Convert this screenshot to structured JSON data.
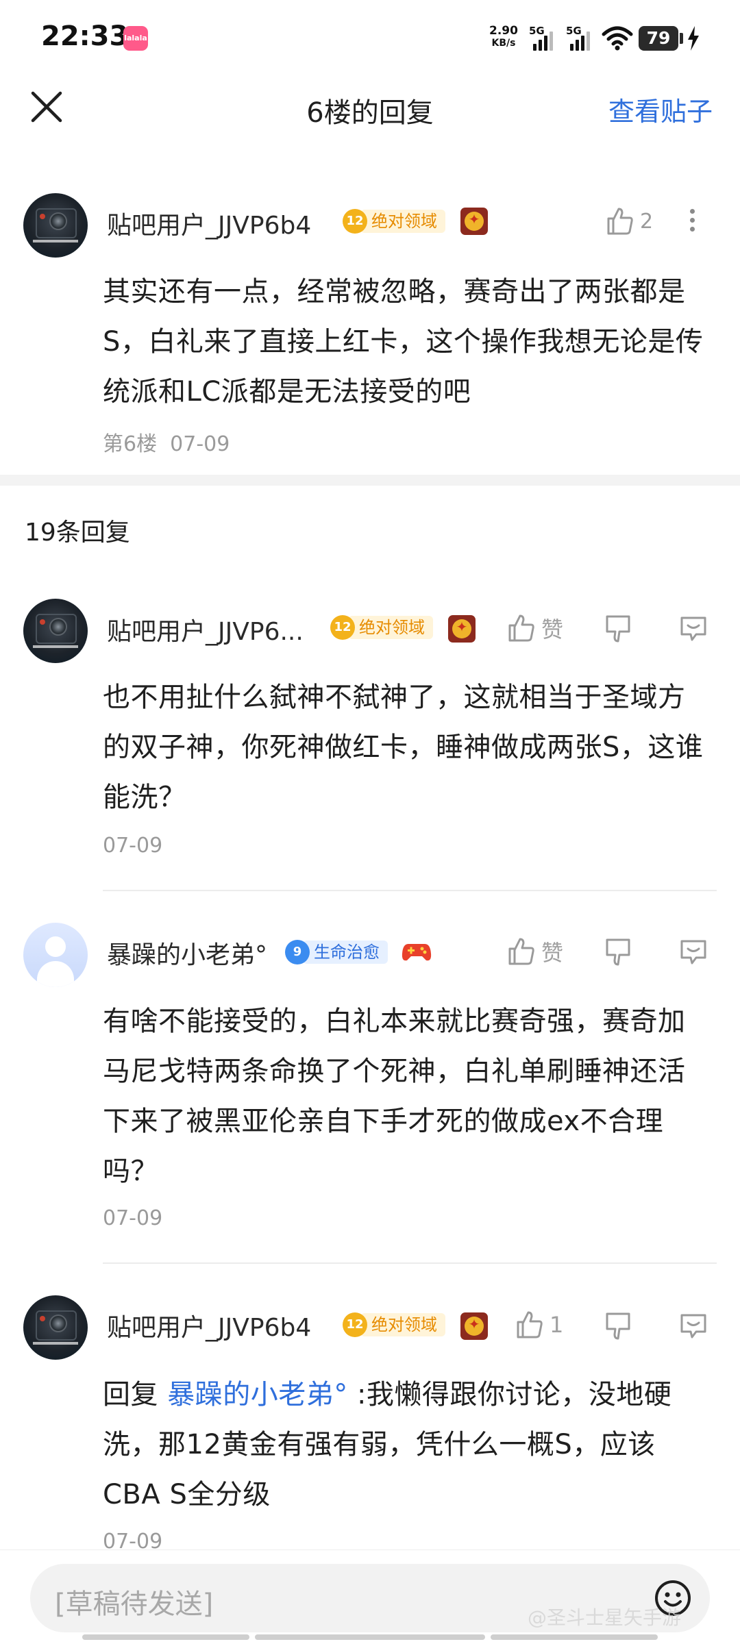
{
  "status_bar": {
    "time": "22:33",
    "app_badge": "lalala",
    "net_speed_value": "2.90",
    "net_speed_unit": "KB/s",
    "sim1": "5G",
    "sim2": "5G",
    "battery": "79"
  },
  "header": {
    "title": "6楼的回复",
    "view_post": "查看贴子"
  },
  "main_post": {
    "user": "贴吧用户_JJVP6b4",
    "level": "12",
    "title_tag": "绝对领域",
    "like_count": "2",
    "content": "其实还有一点，经常被忽略，赛奇出了两张都是S，白礼来了直接上红卡，这个操作我想无论是传统派和LC派都是无法接受的吧",
    "floor": "第6楼",
    "date": "07-09"
  },
  "reply_count": "19条回复",
  "replies": [
    {
      "user": "贴吧用户_JJVP6...",
      "level": "12",
      "title_tag": "绝对领域",
      "like_label": "赞",
      "content": "也不用扯什么弑神不弑神了，这就相当于圣域方的双子神，你死神做红卡，睡神做成两张S，这谁能洗？",
      "date": "07-09"
    },
    {
      "user": "暴躁的小老弟°",
      "level": "9",
      "title_tag": "生命治愈",
      "like_label": "赞",
      "content": "有啥不能接受的，白礼本来就比赛奇强，赛奇加马尼戈特两条命换了个死神，白礼单刷睡神还活下来了被黑亚伦亲自下手才死的做成ex不合理吗？",
      "date": "07-09"
    },
    {
      "user": "贴吧用户_JJVP6b4",
      "level": "12",
      "title_tag": "绝对领域",
      "like_count": "1",
      "reply_prefix": "回复",
      "mention": "暴躁的小老弟°",
      "content": ":我懒得跟你讨论，没地硬洗，那12黄金有强有弱，凭什么一概S，应该CBA S全分级",
      "date": "07-09"
    }
  ],
  "bottom_bar": {
    "draft_placeholder": "[草稿待发送]"
  },
  "watermark": "@圣斗士星矢手游",
  "icons": {
    "close": "close-icon",
    "like": "thumbs-up-icon",
    "dislike": "thumbs-down-icon",
    "comment": "comment-icon",
    "more": "more-vertical-icon",
    "emoji": "emoji-icon"
  }
}
